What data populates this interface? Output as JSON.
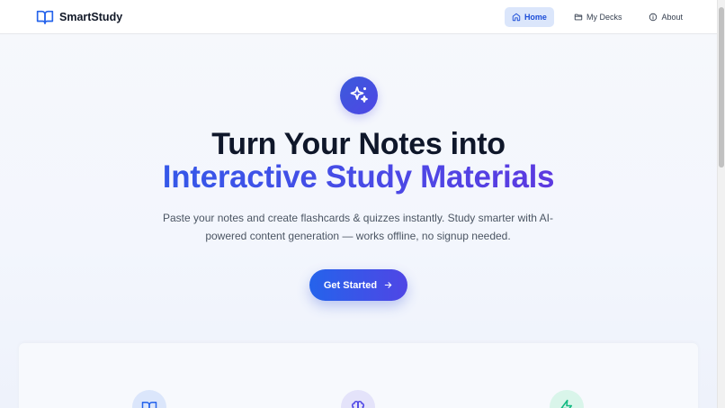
{
  "app": {
    "name": "SmartStudy",
    "brand_icon": "book-open-icon"
  },
  "nav": {
    "items": [
      {
        "label": "Home",
        "icon": "home-icon",
        "active": true
      },
      {
        "label": "My Decks",
        "icon": "folder-icon",
        "active": false
      },
      {
        "label": "About",
        "icon": "info-icon",
        "active": false
      }
    ]
  },
  "hero": {
    "icon": "sparkles-icon",
    "title_line1": "Turn Your Notes into",
    "title_line2": "Interactive Study Materials",
    "description": "Paste your notes and create flashcards & quizzes instantly. Study smarter with AI-powered content generation — works offline, no signup needed.",
    "cta_label": "Get Started",
    "cta_icon": "arrow-right-icon"
  },
  "features": {
    "icons": [
      "book-icon",
      "brain-icon",
      "lightning-icon"
    ]
  },
  "colors": {
    "accent": "#2563eb",
    "accent_secondary": "#4f46e5",
    "nav_active_bg": "#dbe6fb"
  }
}
